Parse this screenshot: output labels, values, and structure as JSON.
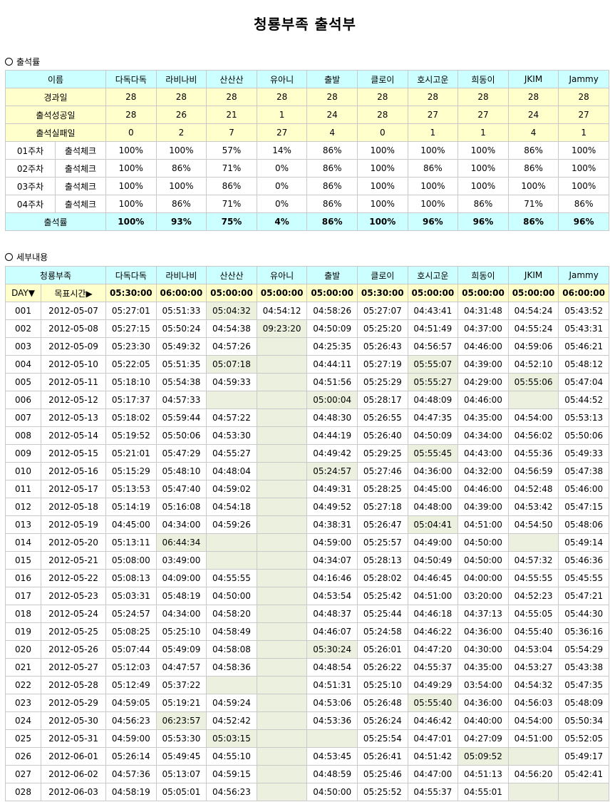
{
  "title": "청룡부족 출석부",
  "section1": "출석률",
  "section2": "세부내용",
  "members": [
    "다독다독",
    "라비나비",
    "산산산",
    "유아니",
    "출발",
    "클로이",
    "호시고운",
    "희동이",
    "JKIM",
    "Jammy"
  ],
  "summary": {
    "name_header": "이름",
    "rows": [
      {
        "label": "경과일",
        "values": [
          "28",
          "28",
          "28",
          "28",
          "28",
          "28",
          "28",
          "28",
          "28",
          "28"
        ]
      },
      {
        "label": "출석성공일",
        "values": [
          "28",
          "26",
          "21",
          "1",
          "24",
          "28",
          "27",
          "27",
          "24",
          "27"
        ]
      },
      {
        "label": "출석실패일",
        "values": [
          "0",
          "2",
          "7",
          "27",
          "4",
          "0",
          "1",
          "1",
          "4",
          "1"
        ]
      }
    ],
    "weeks": [
      {
        "week": "01주차",
        "label": "출석체크",
        "values": [
          "100%",
          "100%",
          "57%",
          "14%",
          "86%",
          "100%",
          "100%",
          "100%",
          "86%",
          "100%"
        ]
      },
      {
        "week": "02주차",
        "label": "출석체크",
        "values": [
          "100%",
          "86%",
          "71%",
          "0%",
          "86%",
          "100%",
          "86%",
          "100%",
          "86%",
          "100%"
        ]
      },
      {
        "week": "03주차",
        "label": "출석체크",
        "values": [
          "100%",
          "100%",
          "86%",
          "0%",
          "86%",
          "100%",
          "100%",
          "100%",
          "100%",
          "100%"
        ]
      },
      {
        "week": "04주차",
        "label": "출석체크",
        "values": [
          "100%",
          "86%",
          "71%",
          "0%",
          "86%",
          "100%",
          "100%",
          "86%",
          "71%",
          "86%"
        ]
      }
    ],
    "rate_label": "출석률",
    "rates": [
      "100%",
      "93%",
      "75%",
      "4%",
      "86%",
      "100%",
      "96%",
      "96%",
      "86%",
      "96%"
    ]
  },
  "detail": {
    "tribe_header": "청룡부족",
    "day_header": "DAY▼",
    "target_header": "목표시간▶",
    "targets": [
      "05:30:00",
      "06:00:00",
      "05:00:00",
      "05:00:00",
      "05:00:00",
      "05:30:00",
      "05:00:00",
      "05:00:00",
      "05:00:00",
      "06:00:00"
    ],
    "rows": [
      {
        "day": "001",
        "date": "2012-05-07",
        "times": [
          "05:27:01",
          "05:51:33",
          "05:04:32",
          "04:54:12",
          "04:58:26",
          "05:27:07",
          "04:43:41",
          "04:31:48",
          "04:54:24",
          "05:43:52"
        ]
      },
      {
        "day": "002",
        "date": "2012-05-08",
        "times": [
          "05:27:15",
          "05:50:24",
          "04:54:38",
          "09:23:20",
          "04:50:09",
          "05:25:20",
          "04:51:49",
          "04:37:00",
          "04:55:24",
          "05:43:31"
        ]
      },
      {
        "day": "003",
        "date": "2012-05-09",
        "times": [
          "05:23:30",
          "05:49:32",
          "04:57:26",
          "",
          "04:25:35",
          "05:26:43",
          "04:56:57",
          "04:46:00",
          "04:59:06",
          "05:46:21"
        ]
      },
      {
        "day": "004",
        "date": "2012-05-10",
        "times": [
          "05:22:05",
          "05:51:35",
          "05:07:18",
          "",
          "04:44:11",
          "05:27:19",
          "05:55:07",
          "04:39:00",
          "04:52:10",
          "05:48:12"
        ]
      },
      {
        "day": "005",
        "date": "2012-05-11",
        "times": [
          "05:18:10",
          "05:54:38",
          "04:59:33",
          "",
          "04:51:56",
          "05:25:29",
          "05:55:27",
          "04:29:00",
          "05:55:06",
          "05:47:04"
        ]
      },
      {
        "day": "006",
        "date": "2012-05-12",
        "times": [
          "05:17:37",
          "04:57:33",
          "",
          "",
          "05:00:04",
          "05:28:17",
          "04:48:09",
          "04:46:00",
          "",
          "05:44:52"
        ]
      },
      {
        "day": "007",
        "date": "2012-05-13",
        "times": [
          "05:18:02",
          "05:59:44",
          "04:57:22",
          "",
          "04:48:30",
          "05:26:55",
          "04:47:35",
          "04:35:00",
          "04:54:00",
          "05:53:13"
        ]
      },
      {
        "day": "008",
        "date": "2012-05-14",
        "times": [
          "05:19:52",
          "05:50:06",
          "04:53:30",
          "",
          "04:44:19",
          "05:26:40",
          "04:50:09",
          "04:34:00",
          "04:56:02",
          "05:50:06"
        ]
      },
      {
        "day": "009",
        "date": "2012-05-15",
        "times": [
          "05:21:01",
          "05:47:29",
          "04:55:27",
          "",
          "04:49:42",
          "05:29:25",
          "05:55:45",
          "04:43:00",
          "04:55:36",
          "05:49:33"
        ]
      },
      {
        "day": "010",
        "date": "2012-05-16",
        "times": [
          "05:15:29",
          "05:48:10",
          "04:48:04",
          "",
          "05:24:57",
          "05:27:46",
          "04:36:00",
          "04:32:00",
          "04:56:59",
          "05:47:38"
        ]
      },
      {
        "day": "011",
        "date": "2012-05-17",
        "times": [
          "05:13:53",
          "05:47:40",
          "04:59:02",
          "",
          "04:49:31",
          "05:28:25",
          "04:45:00",
          "04:46:00",
          "04:52:48",
          "05:46:00"
        ]
      },
      {
        "day": "012",
        "date": "2012-05-18",
        "times": [
          "05:14:19",
          "05:16:08",
          "04:54:18",
          "",
          "04:49:52",
          "05:27:18",
          "04:48:00",
          "04:39:00",
          "04:53:42",
          "05:47:15"
        ]
      },
      {
        "day": "013",
        "date": "2012-05-19",
        "times": [
          "04:45:00",
          "04:34:00",
          "04:59:26",
          "",
          "04:38:31",
          "05:26:47",
          "05:04:41",
          "04:51:00",
          "04:54:50",
          "05:48:06"
        ]
      },
      {
        "day": "014",
        "date": "2012-05-20",
        "times": [
          "05:13:11",
          "06:44:34",
          "",
          "",
          "04:59:00",
          "05:25:57",
          "04:49:00",
          "04:50:00",
          "",
          "05:49:14"
        ]
      },
      {
        "day": "015",
        "date": "2012-05-21",
        "times": [
          "05:08:00",
          "03:49:00",
          "",
          "",
          "04:34:07",
          "05:28:13",
          "04:50:49",
          "04:50:00",
          "04:57:32",
          "05:46:36"
        ]
      },
      {
        "day": "016",
        "date": "2012-05-22",
        "times": [
          "05:08:13",
          "04:09:00",
          "04:55:55",
          "",
          "04:16:46",
          "05:28:02",
          "04:46:45",
          "04:00:00",
          "04:55:55",
          "05:45:55"
        ]
      },
      {
        "day": "017",
        "date": "2012-05-23",
        "times": [
          "05:03:31",
          "05:48:19",
          "04:50:00",
          "",
          "04:53:54",
          "05:25:42",
          "04:51:00",
          "03:20:00",
          "04:52:23",
          "05:47:21"
        ]
      },
      {
        "day": "018",
        "date": "2012-05-24",
        "times": [
          "05:24:57",
          "04:34:00",
          "04:58:20",
          "",
          "04:48:37",
          "05:25:44",
          "04:46:18",
          "04:37:13",
          "04:55:05",
          "05:44:30"
        ]
      },
      {
        "day": "019",
        "date": "2012-05-25",
        "times": [
          "05:08:25",
          "05:25:10",
          "04:58:49",
          "",
          "04:46:07",
          "05:24:58",
          "04:46:22",
          "04:36:00",
          "04:55:40",
          "05:36:16"
        ]
      },
      {
        "day": "020",
        "date": "2012-05-26",
        "times": [
          "05:07:44",
          "05:49:09",
          "04:58:08",
          "",
          "05:30:24",
          "05:26:01",
          "04:47:20",
          "04:30:00",
          "04:53:04",
          "05:54:29"
        ]
      },
      {
        "day": "021",
        "date": "2012-05-27",
        "times": [
          "05:12:03",
          "04:47:57",
          "04:58:36",
          "",
          "04:48:54",
          "05:26:22",
          "04:55:37",
          "04:35:00",
          "04:53:27",
          "05:43:38"
        ]
      },
      {
        "day": "022",
        "date": "2012-05-28",
        "times": [
          "05:12:49",
          "05:37:22",
          "",
          "",
          "04:51:31",
          "05:25:10",
          "04:49:29",
          "03:54:00",
          "04:54:32",
          "05:47:35"
        ]
      },
      {
        "day": "023",
        "date": "2012-05-29",
        "times": [
          "04:59:05",
          "05:19:21",
          "04:59:24",
          "",
          "04:53:06",
          "05:26:48",
          "05:55:40",
          "04:36:00",
          "04:56:03",
          "05:48:09"
        ]
      },
      {
        "day": "024",
        "date": "2012-05-30",
        "times": [
          "04:56:23",
          "06:23:57",
          "04:52:42",
          "",
          "04:53:36",
          "05:26:24",
          "04:46:42",
          "04:40:00",
          "04:54:00",
          "05:50:34"
        ]
      },
      {
        "day": "025",
        "date": "2012-05-31",
        "times": [
          "04:59:00",
          "05:53:30",
          "05:03:15",
          "",
          "",
          "05:25:54",
          "04:47:01",
          "04:27:09",
          "04:51:00",
          "05:52:05"
        ]
      },
      {
        "day": "026",
        "date": "2012-06-01",
        "times": [
          "05:26:14",
          "05:49:45",
          "04:55:10",
          "",
          "04:53:45",
          "05:26:41",
          "04:51:42",
          "05:09:52",
          "",
          "05:49:17"
        ]
      },
      {
        "day": "027",
        "date": "2012-06-02",
        "times": [
          "04:57:36",
          "05:13:07",
          "04:59:15",
          "",
          "04:48:59",
          "05:25:46",
          "04:47:00",
          "04:51:13",
          "04:56:20",
          "05:42:41"
        ]
      },
      {
        "day": "028",
        "date": "2012-06-03",
        "times": [
          "04:58:19",
          "05:05:01",
          "04:56:23",
          "",
          "04:50:00",
          "05:25:52",
          "04:55:37",
          "04:55:01",
          "",
          ""
        ]
      }
    ],
    "fail_color": "#ebf1de"
  }
}
